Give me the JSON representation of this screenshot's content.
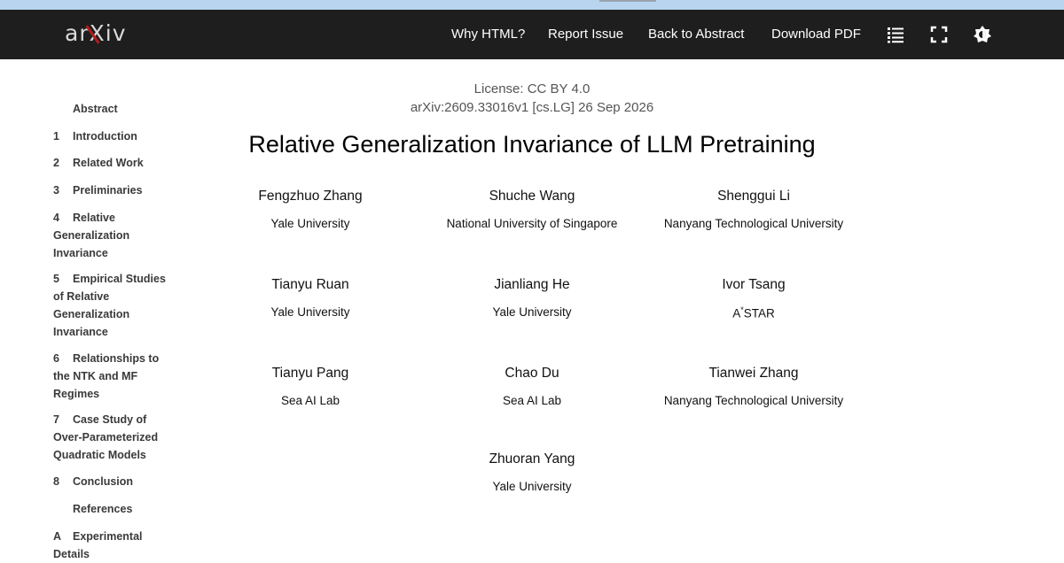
{
  "nav": {
    "logo": "arXiv",
    "links": [
      "Why HTML?",
      "Report Issue",
      "Back to Abstract",
      "Download PDF"
    ],
    "icons": [
      "list-icon",
      "fullscreen-icon",
      "theme-toggle-icon"
    ]
  },
  "toc": [
    {
      "num": "",
      "label": "Abstract"
    },
    {
      "num": "1",
      "label": "Introduction"
    },
    {
      "num": "2",
      "label": "Related Work"
    },
    {
      "num": "3",
      "label": "Preliminaries"
    },
    {
      "num": "4",
      "label": "Relative Generalization Invariance"
    },
    {
      "num": "5",
      "label": "Empirical Studies of Relative Generalization Invariance"
    },
    {
      "num": "6",
      "label": "Relationships to the NTK and MF Regimes"
    },
    {
      "num": "7",
      "label": "Case Study of Over-Parameterized Quadratic Models"
    },
    {
      "num": "8",
      "label": "Conclusion"
    },
    {
      "num": "",
      "label": "References"
    },
    {
      "num": "A",
      "label": "Experimental Details"
    }
  ],
  "paper": {
    "license": "License: CC BY 4.0",
    "arxiv_id": "arXiv:2609.33016v1 [cs.LG] 26 Sep 2026",
    "title": "Relative Generalization Invariance of LLM Pretraining"
  },
  "authors": [
    {
      "name": "Fengzhuo Zhang",
      "affiliation": "Yale University"
    },
    {
      "name": "Shuche Wang",
      "affiliation": "National University of Singapore"
    },
    {
      "name": "Shenggui Li",
      "affiliation": "Nanyang Technological University"
    },
    {
      "name": "Tianyu Ruan",
      "affiliation": "Yale University"
    },
    {
      "name": "Jianliang He",
      "affiliation": "Yale University"
    },
    {
      "name": "Ivor Tsang",
      "affiliation_prefix": "A",
      "affiliation_sup": "*",
      "affiliation_suffix": "STAR"
    },
    {
      "name": "Tianyu Pang",
      "affiliation": "Sea AI Lab"
    },
    {
      "name": "Chao Du",
      "affiliation": "Sea AI Lab"
    },
    {
      "name": "Tianwei Zhang",
      "affiliation": "Nanyang Technological University"
    },
    {
      "name": "Zhuoran Yang",
      "affiliation": "Yale University"
    }
  ]
}
